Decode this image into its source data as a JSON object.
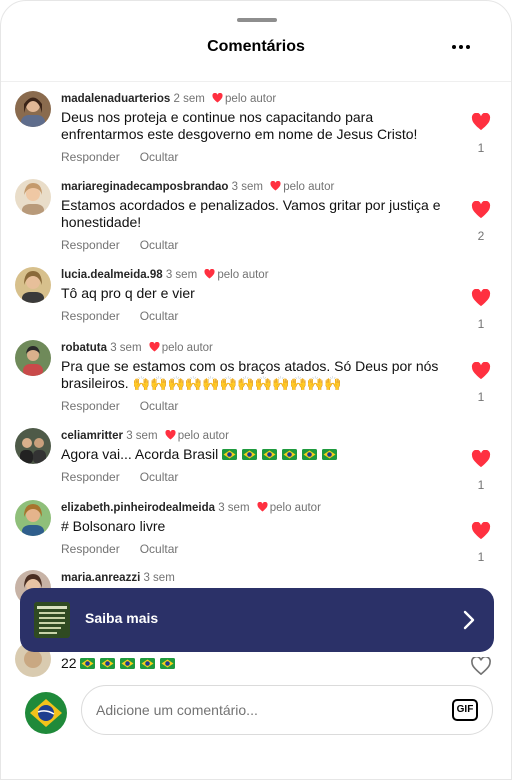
{
  "header": {
    "title": "Comentários",
    "more_icon": "more-horizontal-icon"
  },
  "comments": [
    {
      "username": "madalenaduarterios",
      "time": "2 sem",
      "author_badge": "pelo autor",
      "text": "Deus nos proteja e continue nos capacitando para enfrentarmos este desgoverno em nome de Jesus Cristo!",
      "reply": "Responder",
      "hide": "Ocultar",
      "likes": "1",
      "liked": true
    },
    {
      "username": "mariareginadecamposbrandao",
      "time": "3 sem",
      "author_badge": "pelo autor",
      "text": "Estamos acordados e penalizados. Vamos gritar por justiça e honestidade!",
      "reply": "Responder",
      "hide": "Ocultar",
      "likes": "2",
      "liked": true
    },
    {
      "username": "lucia.dealmeida.98",
      "time": "3 sem",
      "author_badge": "pelo autor",
      "text": "Tô aq pro q der e vier",
      "reply": "Responder",
      "hide": "Ocultar",
      "likes": "1",
      "liked": true
    },
    {
      "username": "robatuta",
      "time": "3 sem",
      "author_badge": "pelo autor",
      "text": "Pra que se estamos com os braços atados. Só Deus por nós brasileiros. 🙌🙌🙌🙌🙌🙌🙌🙌🙌🙌🙌🙌",
      "reply": "Responder",
      "hide": "Ocultar",
      "likes": "1",
      "liked": true
    },
    {
      "username": "celiamritter",
      "time": "3 sem",
      "author_badge": "pelo autor",
      "text": "Agora vai... Acorda Brasil",
      "flags": 6,
      "reply": "Responder",
      "hide": "Ocultar",
      "likes": "1",
      "liked": true
    },
    {
      "username": "elizabeth.pinheirodealmeida",
      "time": "3 sem",
      "author_badge": "pelo autor",
      "text": "# Bolsonaro livre",
      "reply": "Responder",
      "hide": "Ocultar",
      "likes": "1",
      "liked": true
    },
    {
      "username": "maria.anreazzi",
      "time": "3 sem"
    },
    {
      "text": "22",
      "flags": 5,
      "liked": false
    }
  ],
  "banner": {
    "label": "Saiba mais",
    "chevron_icon": "chevron-right-icon"
  },
  "composer": {
    "placeholder": "Adicione um comentário...",
    "gif_label": "GIF"
  },
  "colors": {
    "heart": "#ff3040",
    "banner_bg": "#2b3168",
    "muted": "#737373"
  }
}
